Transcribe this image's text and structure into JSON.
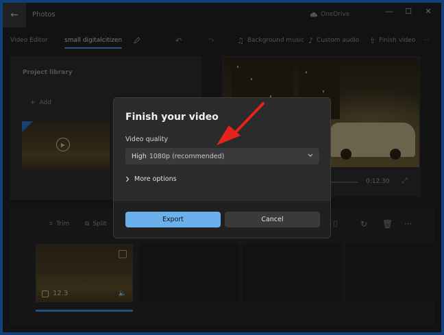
{
  "window": {
    "title": "Photos",
    "onedrive_label": "OneDrive",
    "controls": [
      "—",
      "☐",
      "✕"
    ]
  },
  "toolbar": {
    "video_editor": "Video Editor",
    "project_name": "small digitalcitizen",
    "background_music": "Background music",
    "custom_audio": "Custom audio",
    "finish_video": "Finish video",
    "more": "···"
  },
  "library": {
    "title": "Project library",
    "add_label": "Add"
  },
  "preview": {
    "time": "0:12.30"
  },
  "timeline": {
    "trim": "Trim",
    "split": "Split",
    "more": "···",
    "clip_duration": "12.3"
  },
  "dialog": {
    "title": "Finish your video",
    "quality_label": "Video quality",
    "quality_value": "High",
    "quality_detail": "1080p (recommended)",
    "more_options": "More options",
    "export_label": "Export",
    "cancel_label": "Cancel"
  },
  "colors": {
    "accent": "#6ab0ea",
    "arrow": "#e8231c",
    "window_bg": "#202020"
  }
}
